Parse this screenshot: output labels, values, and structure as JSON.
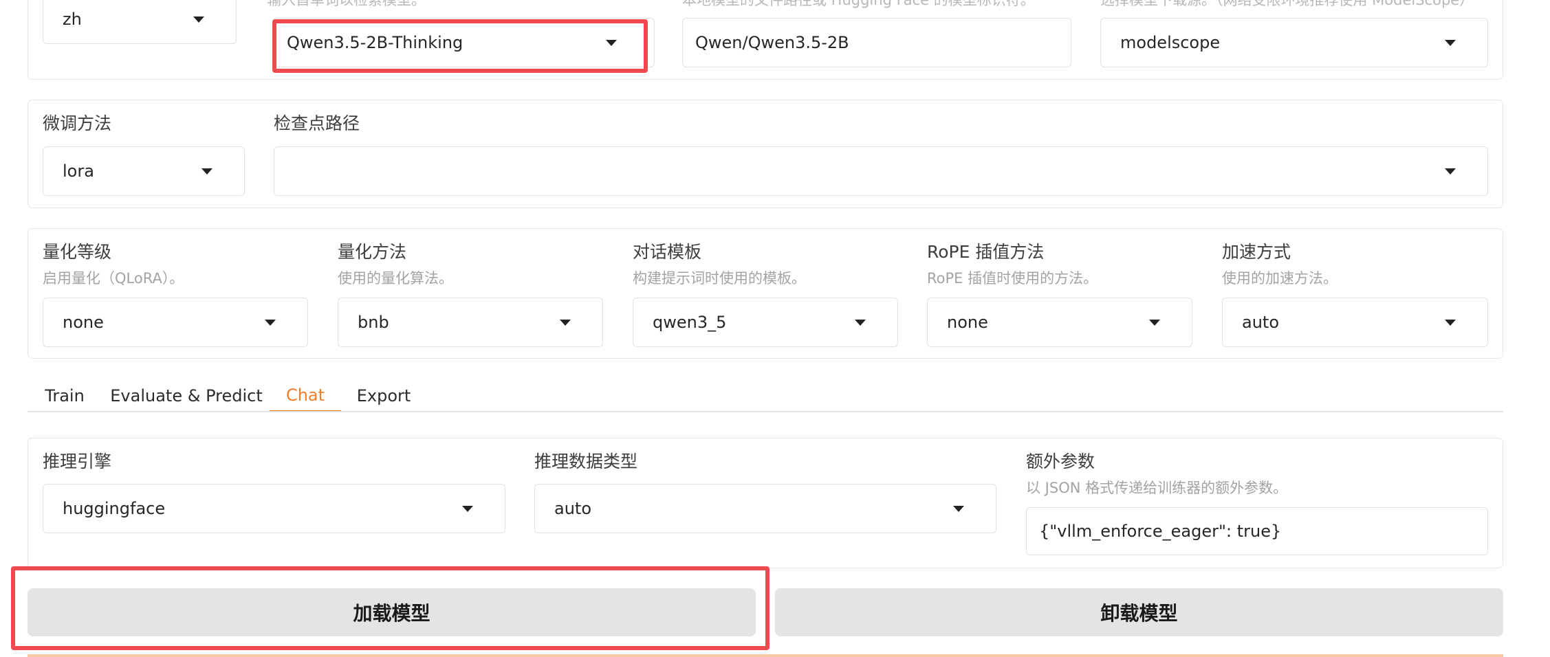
{
  "top_row": {
    "language": {
      "value": "zh"
    },
    "model_name": {
      "value": "Qwen3.5-2B-Thinking",
      "info_partial": "输入首单词以检索模型。"
    },
    "model_path": {
      "value": "Qwen/Qwen3.5-2B",
      "info_partial": "本地模型的文件路径或 Hugging Face 的模型标识符。"
    },
    "hub": {
      "value": "modelscope",
      "info_partial": "选择模型下载源。（网络受限环境推荐使用 ModelScope）"
    }
  },
  "finetune_row": {
    "finetune_method": {
      "label": "微调方法",
      "value": "lora"
    },
    "checkpoint_path": {
      "label": "检查点路径",
      "value": ""
    }
  },
  "advanced_row": {
    "quant_bit": {
      "label": "量化等级",
      "info": "启用量化（QLoRA）。",
      "value": "none"
    },
    "quant_method": {
      "label": "量化方法",
      "info": "使用的量化算法。",
      "value": "bnb"
    },
    "template": {
      "label": "对话模板",
      "info": "构建提示词时使用的模板。",
      "value": "qwen3_5"
    },
    "rope_scaling": {
      "label": "RoPE 插值方法",
      "info": "RoPE 插值时使用的方法。",
      "value": "none"
    },
    "booster": {
      "label": "加速方式",
      "info": "使用的加速方法。",
      "value": "auto"
    }
  },
  "tabs": [
    {
      "label": "Train"
    },
    {
      "label": "Evaluate & Predict"
    },
    {
      "label": "Chat"
    },
    {
      "label": "Export"
    }
  ],
  "chat": {
    "infer_backend": {
      "label": "推理引擎",
      "value": "huggingface"
    },
    "infer_dtype": {
      "label": "推理数据类型",
      "value": "auto"
    },
    "extra_args": {
      "label": "额外参数",
      "info": "以 JSON 格式传递给训练器的额外参数。",
      "value": "{\"vllm_enforce_eager\": true}"
    }
  },
  "buttons": {
    "load_model": "加载模型",
    "unload_model": "卸载模型"
  },
  "colors": {
    "accent": "#f07d29",
    "highlight": "#ee4a4f",
    "button_bg": "#e4e4e7",
    "border": "#e2e2e6"
  }
}
